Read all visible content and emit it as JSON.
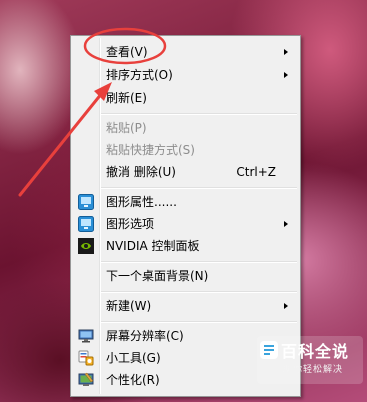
{
  "context_menu": {
    "items": {
      "view": {
        "label": "查看(V)",
        "has_submenu": true
      },
      "sort": {
        "label": "排序方式(O)",
        "has_submenu": true
      },
      "refresh": {
        "label": "刷新(E)"
      },
      "paste": {
        "label": "粘贴(P)",
        "disabled": true
      },
      "paste_shortcut": {
        "label": "粘贴快捷方式(S)",
        "disabled": true
      },
      "undo_delete": {
        "label": "撤消 删除(U)",
        "shortcut": "Ctrl+Z"
      },
      "graphics_properties": {
        "label": "图形属性......",
        "icon": "intel-graphics-icon"
      },
      "graphics_options": {
        "label": "图形选项",
        "icon": "intel-graphics-icon",
        "has_submenu": true
      },
      "nvidia_panel": {
        "label": "NVIDIA 控制面板",
        "icon": "nvidia-icon"
      },
      "next_background": {
        "label": "下一个桌面背景(N)"
      },
      "new": {
        "label": "新建(W)",
        "has_submenu": true
      },
      "screen_resolution": {
        "label": "屏幕分辨率(C)",
        "icon": "monitor-icon"
      },
      "gadgets": {
        "label": "小工具(G)",
        "icon": "gadgets-icon"
      },
      "personalize": {
        "label": "个性化(R)",
        "icon": "personalize-icon"
      }
    }
  },
  "annotation": {
    "color": "#e8403c"
  },
  "watermark": {
    "title": "百科全说",
    "subtitle": "助你轻松解决"
  }
}
